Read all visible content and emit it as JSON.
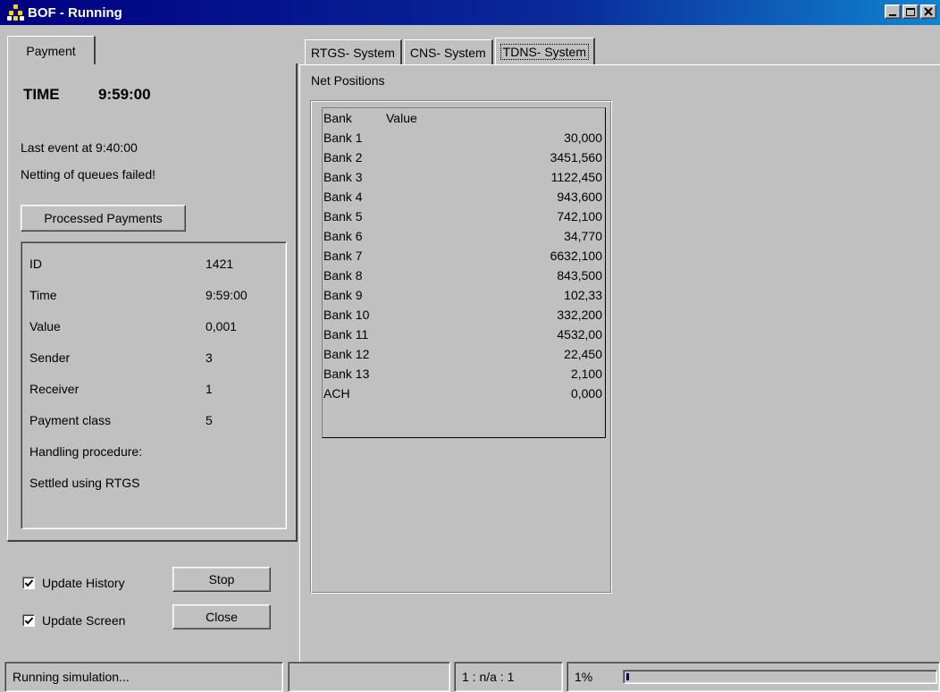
{
  "window": {
    "title": "BOF - Running",
    "icon": "bof-app-icon"
  },
  "left": {
    "tab_label": "Payment",
    "time_label": "TIME",
    "time_value": "9:59:00",
    "last_event": "Last event at  9:40:00",
    "status_msg": "Netting of queues failed!",
    "processed_button": "Processed Payments",
    "details": [
      {
        "key": "ID",
        "value": "1421"
      },
      {
        "key": "Time",
        "value": "9:59:00"
      },
      {
        "key": "Value",
        "value": "0,001"
      },
      {
        "key": "Sender",
        "value": "3"
      },
      {
        "key": "Receiver",
        "value": "1"
      },
      {
        "key": "Payment class",
        "value": "5"
      },
      {
        "key": "Handling procedure:",
        "value": ""
      },
      {
        "key": "Settled using RTGS",
        "value": ""
      }
    ],
    "update_history": {
      "label": "Update History",
      "checked": true
    },
    "update_screen": {
      "label": "Update Screen",
      "checked": true
    },
    "stop_button": "Stop",
    "close_button": "Close"
  },
  "right": {
    "tabs": [
      {
        "label": "RTGS- System",
        "active": false
      },
      {
        "label": "CNS- System",
        "active": false
      },
      {
        "label": "TDNS- System",
        "active": true
      }
    ],
    "net_title": "Net Positions",
    "col_bank": "Bank",
    "col_value": "Value",
    "rows": [
      {
        "bank": "Bank 1",
        "value": "30,000"
      },
      {
        "bank": "Bank 2",
        "value": "3451,560"
      },
      {
        "bank": "Bank 3",
        "value": "1122,450"
      },
      {
        "bank": "Bank 4",
        "value": "943,600"
      },
      {
        "bank": "Bank 5",
        "value": "742,100"
      },
      {
        "bank": "Bank 6",
        "value": "34,770"
      },
      {
        "bank": "Bank 7",
        "value": "6632,100"
      },
      {
        "bank": "Bank 8",
        "value": "843,500"
      },
      {
        "bank": "Bank 9",
        "value": "102,33"
      },
      {
        "bank": "Bank 10",
        "value": "332,200"
      },
      {
        "bank": "Bank 11",
        "value": "4532,00"
      },
      {
        "bank": "Bank 12",
        "value": "22,450"
      },
      {
        "bank": "Bank 13",
        "value": "2,100"
      },
      {
        "bank": "ACH",
        "value": "0,000"
      }
    ]
  },
  "status": {
    "message": "Running simulation...",
    "cell2": "",
    "ratio": "1 : n/a : 1",
    "percent": "1%",
    "progress": 0.01
  }
}
